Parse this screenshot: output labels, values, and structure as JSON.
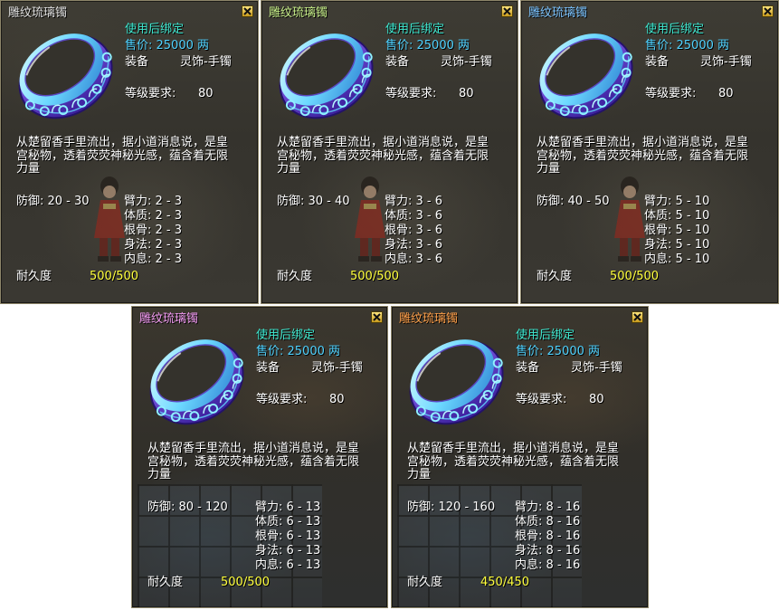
{
  "icons": {
    "close": "close-icon",
    "item": "bracelet-icon"
  },
  "colors": {
    "bind_text": "#3ee8d0",
    "price": "#4fd2ff",
    "durability_value": "#ffff3c"
  },
  "panels": [
    {
      "title": "雕纹琉璃镯",
      "title_color": "#e0e0e0",
      "bind_text": "使用后绑定",
      "price": "售价: 25000 两",
      "equip_label": "装备",
      "equip_type": "灵饰-手镯",
      "level_label": "等级要求:",
      "level_value": "80",
      "desc_lines": [
        "从楚留香手里流出，据小道消息说，是皇",
        "宫秘物，透着荧荧神秘光感，蕴含着无限",
        "力量"
      ],
      "defense": "防御: 20 - 30",
      "attributes": [
        "臂力: 2 - 3",
        "体质: 2 - 3",
        "根骨: 2 - 3",
        "身法: 2 - 3",
        "内息: 2 - 3"
      ],
      "durability_label": "耐久度",
      "durability_value": "500/500"
    },
    {
      "title": "雕纹琉璃镯",
      "title_color": "#c8f08a",
      "bind_text": "使用后绑定",
      "price": "售价: 25000 两",
      "equip_label": "装备",
      "equip_type": "灵饰-手镯",
      "level_label": "等级要求:",
      "level_value": "80",
      "desc_lines": [
        "从楚留香手里流出，据小道消息说，是皇",
        "宫秘物，透着荧荧神秘光感，蕴含着无限",
        "力量"
      ],
      "defense": "防御: 30 - 40",
      "attributes": [
        "臂力: 3 - 6",
        "体质: 3 - 6",
        "根骨: 3 - 6",
        "身法: 3 - 6",
        "内息: 3 - 6"
      ],
      "durability_label": "耐久度",
      "durability_value": "500/500"
    },
    {
      "title": "雕纹琉璃镯",
      "title_color": "#7cc4ff",
      "bind_text": "使用后绑定",
      "price": "售价: 25000 两",
      "equip_label": "装备",
      "equip_type": "灵饰-手镯",
      "level_label": "等级要求:",
      "level_value": "80",
      "desc_lines": [
        "从楚留香手里流出，据小道消息说，是皇",
        "宫秘物，透着荧荧神秘光感，蕴含着无限",
        "力量"
      ],
      "defense": "防御: 40 - 50",
      "attributes": [
        "臂力: 5 - 10",
        "体质: 5 - 10",
        "根骨: 5 - 10",
        "身法: 5 - 10",
        "内息: 5 - 10"
      ],
      "durability_label": "耐久度",
      "durability_value": "500/500"
    },
    {
      "title": "雕纹琉璃镯",
      "title_color": "#f49cf4",
      "bind_text": "使用后绑定",
      "price": "售价: 25000 两",
      "equip_label": "装备",
      "equip_type": "灵饰-手镯",
      "level_label": "等级要求:",
      "level_value": "80",
      "desc_lines": [
        "从楚留香手里流出，据小道消息说，是皇",
        "宫秘物，透着荧荧神秘光感，蕴含着无限",
        "力量"
      ],
      "defense": "防御: 80 - 120",
      "attributes": [
        "臂力: 6 - 13",
        "体质: 6 - 13",
        "根骨: 6 - 13",
        "身法: 6 - 13",
        "内息: 6 - 13"
      ],
      "durability_label": "耐久度",
      "durability_value": "500/500"
    },
    {
      "title": "雕纹琉璃镯",
      "title_color": "#ffa04a",
      "bind_text": "使用后绑定",
      "price": "售价: 25000 两",
      "equip_label": "装备",
      "equip_type": "灵饰-手镯",
      "level_label": "等级要求:",
      "level_value": "80",
      "desc_lines": [
        "从楚留香手里流出，据小道消息说，是皇",
        "宫秘物，透着荧荧神秘光感，蕴含着无限",
        "力量"
      ],
      "defense": "防御: 120 - 160",
      "attributes": [
        "臂力: 8 - 16",
        "体质: 8 - 16",
        "根骨: 8 - 16",
        "身法: 8 - 16",
        "内息: 8 - 16"
      ],
      "durability_label": "耐久度",
      "durability_value": "450/450"
    }
  ]
}
